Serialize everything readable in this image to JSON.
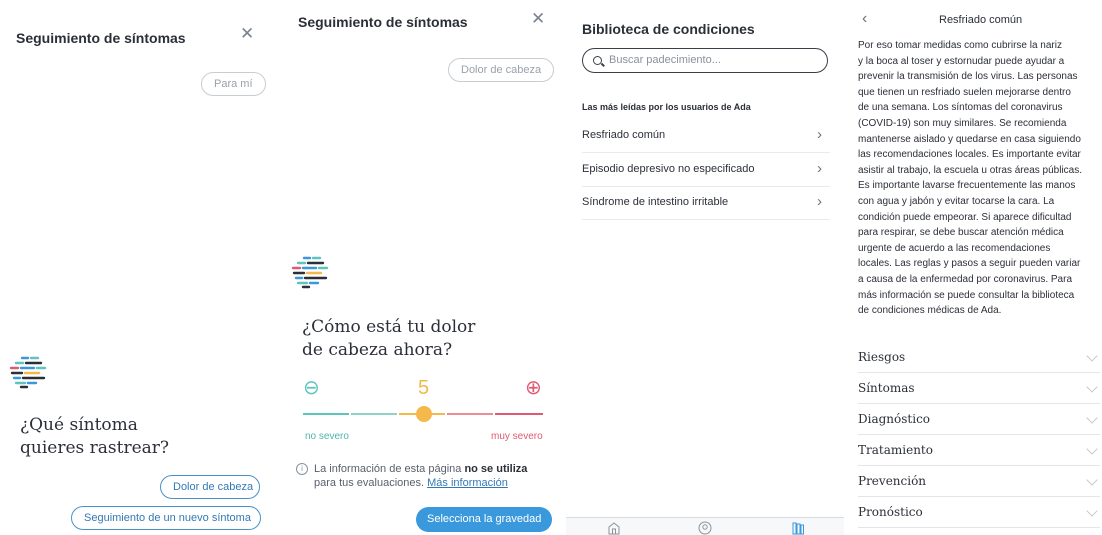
{
  "panel1": {
    "title": "Seguimiento de síntomas",
    "close_icon": "close-icon",
    "chip": "Para mí",
    "question_line1": "¿Qué síntoma",
    "question_line2": "quieres rastrear?",
    "option1": "Dolor de cabeza",
    "option2": "Seguimiento de un nuevo síntoma"
  },
  "panel2": {
    "title": "Seguimiento de síntomas",
    "close_icon": "close-icon",
    "chip": "Dolor de cabeza",
    "question_line1": "¿Cómo está tu dolor",
    "question_line2": "de cabeza ahora?",
    "severity_value": "5",
    "minus_icon": "minus-circle-icon",
    "plus_icon": "plus-circle-icon",
    "label_low": "no severo",
    "label_high": "muy severo",
    "info_text1": "La información de esta página ",
    "info_bold": "no se utiliza",
    "info_text2": "para tus evaluaciones. ",
    "info_link": "Más información",
    "primary_button": "Selecciona la gravedad"
  },
  "panel3": {
    "title": "Biblioteca de condiciones",
    "search_placeholder": "Buscar padecimiento...",
    "section_title": "Las más leídas por los usuarios de Ada",
    "conditions": [
      {
        "label": "Resfriado común"
      },
      {
        "label": "Episodio depresivo no especificado"
      },
      {
        "label": "Síndrome de intestino irritable"
      }
    ],
    "tabs": [
      "home-icon",
      "profile-icon",
      "library-icon"
    ]
  },
  "panel4": {
    "title": "Resfriado común",
    "back_icon": "chevron-left-icon",
    "body_lines": [
      "Por eso tomar medidas como cubrirse la nariz",
      "y la boca al toser y estornudar puede ayudar a",
      "prevenir la transmisión de los virus. Las personas",
      "que tienen un resfriado suelen mejorarse dentro",
      "de una semana. Los síntomas del coronavirus",
      "(COVID-19) son muy similares. Se recomienda",
      "mantenerse aislado y quedarse en casa siguiendo",
      "las recomendaciones locales. Es importante evitar",
      "asistir al trabajo, la escuela u otras áreas públicas.",
      "Es importante lavarse frecuentemente las manos",
      "con agua y jabón y evitar tocarse la cara. La",
      "condición puede empeorar. Si aparece dificultad",
      "para respirar, se debe buscar atención médica",
      "urgente de acuerdo a las recomendaciones",
      "locales. Las reglas y pasos a seguir pueden variar",
      "a causa de la enfermedad por coronavirus. Para",
      "más información se puede consultar la biblioteca",
      "de condiciones médicas de Ada."
    ],
    "sections": [
      "Riesgos",
      "Síntomas",
      "Diagnóstico",
      "Tratamiento",
      "Prevención",
      "Pronóstico"
    ]
  },
  "colors": {
    "accent_blue": "#3a98dc",
    "severity_low": "#5ec4be",
    "severity_mid": "#f5b84a",
    "severity_high": "#e05a73"
  }
}
